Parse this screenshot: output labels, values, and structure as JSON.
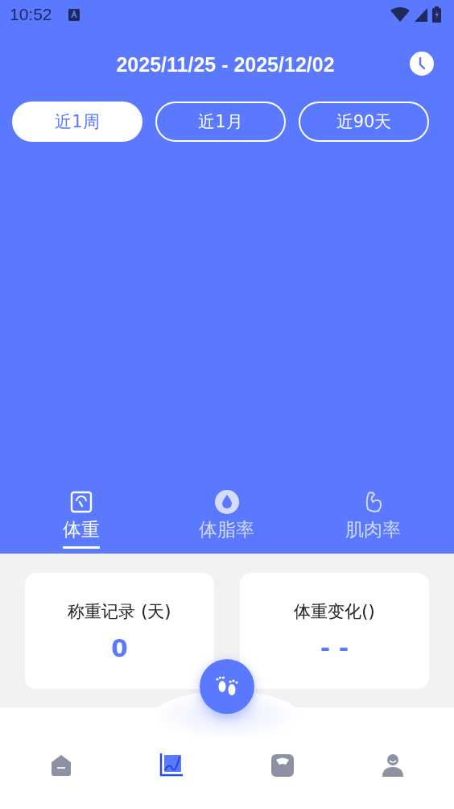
{
  "status_bar": {
    "time": "10:52"
  },
  "date_range": "2025/11/25 - 2025/12/02",
  "period_tabs": [
    {
      "label": "近1周",
      "selected": true
    },
    {
      "label": "近1月",
      "selected": false
    },
    {
      "label": "近90天",
      "selected": false
    }
  ],
  "metric_tabs": [
    {
      "label": "体重",
      "selected": true
    },
    {
      "label": "体脂率",
      "selected": false
    },
    {
      "label": "肌肉率",
      "selected": false
    }
  ],
  "cards": [
    {
      "label": "称重记录 (天)",
      "value": "0"
    },
    {
      "label": "体重变化()",
      "value": "- -"
    }
  ],
  "bottom_nav": [
    {
      "selected": false
    },
    {
      "selected": true
    },
    {
      "selected": false
    },
    {
      "selected": false
    }
  ]
}
